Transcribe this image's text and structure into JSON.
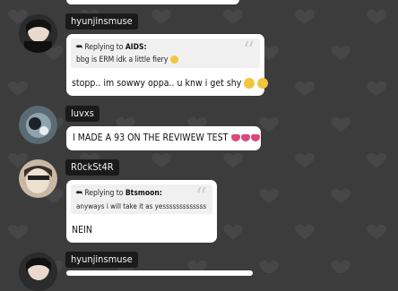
{
  "messages": [
    {
      "username": "hyunjinsmuse",
      "reply": {
        "prefix": "Replying to",
        "to": "AIDS:",
        "text": "bbg is ERM idk a little fiery"
      },
      "text": "stopp.. im sowwy oppa.. u knw i get shy"
    },
    {
      "username": "luvxs",
      "text": "I MADE A 93 ON THE REVIWEW TEST"
    },
    {
      "username": "R0ckSt4R",
      "reply": {
        "prefix": "Replying to",
        "to": "Btsmoon:",
        "text": "anyways i will take it as yesssssssssssss"
      },
      "text": "NEIN"
    },
    {
      "username": "hyunjinsmuse"
    }
  ],
  "icons": {
    "reply": "reply-arrow-icon",
    "quote": "quote-icon",
    "emoji_pleading": "pleading-face-emoji",
    "emoji_tongue": "tongue-emoji"
  },
  "colors": {
    "background": "#3c3c3c",
    "name_tag": "#1a1a1a",
    "bubble": "#ffffff"
  }
}
